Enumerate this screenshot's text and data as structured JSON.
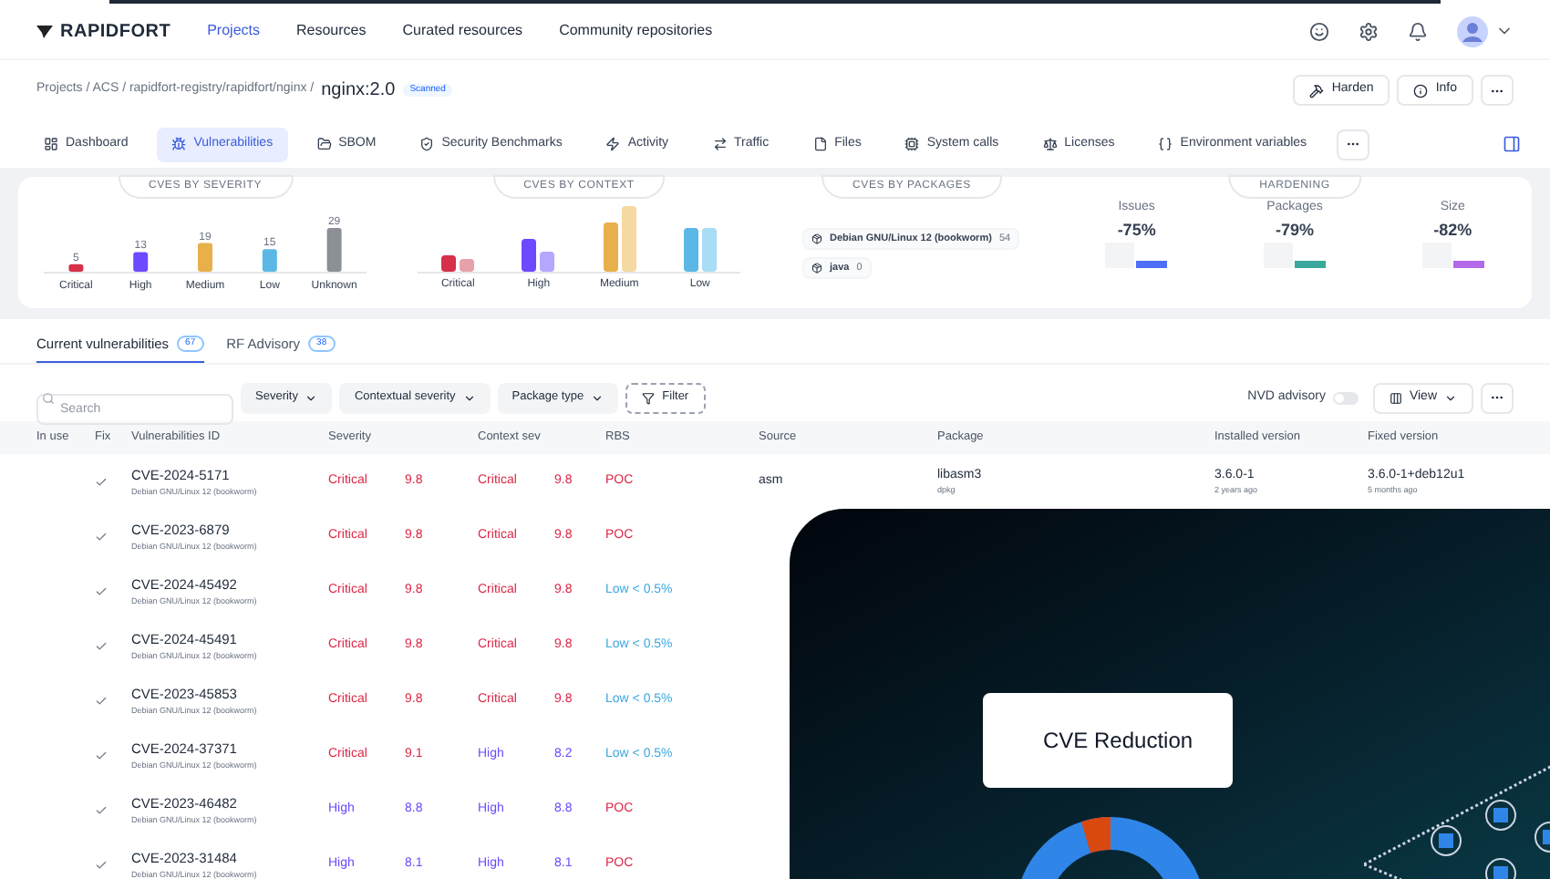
{
  "nav": {
    "brand": "RAPIDFORT",
    "items": [
      {
        "label": "Projects",
        "selected": true
      },
      {
        "label": "Resources",
        "selected": false
      },
      {
        "label": "Curated resources",
        "selected": false
      },
      {
        "label": "Community repositories",
        "selected": false
      }
    ]
  },
  "breadcrumb": {
    "path": "Projects / ACS / rapidfort-registry/rapidfort/nginx /",
    "image": "nginx:2.0",
    "badge": "Scanned",
    "actions": [
      "Harden",
      "Info"
    ]
  },
  "tabs": [
    {
      "label": "Dashboard",
      "selected": false
    },
    {
      "label": "Vulnerabilities",
      "selected": true
    },
    {
      "label": "SBOM",
      "selected": false
    },
    {
      "label": "Security Benchmarks",
      "selected": false
    },
    {
      "label": "Activity",
      "selected": false
    },
    {
      "label": "Traffic",
      "selected": false
    },
    {
      "label": "Files",
      "selected": false
    },
    {
      "label": "System calls",
      "selected": false
    },
    {
      "label": "Licenses",
      "selected": false
    },
    {
      "label": "Environment variables",
      "selected": false
    }
  ],
  "summary": {
    "severity": {
      "heading": "CVES BY SEVERITY",
      "chart_data": {
        "type": "bar",
        "categories": [
          "Critical",
          "High",
          "Medium",
          "Low",
          "Unknown"
        ],
        "values": [
          5,
          13,
          19,
          15,
          29
        ],
        "data_labels": true
      }
    },
    "context": {
      "heading": "CVES BY CONTEXT",
      "categories": [
        "Critical",
        "High",
        "Medium",
        "Low"
      ]
    },
    "packages": {
      "heading": "CVES BY PACKAGES",
      "items": [
        {
          "name": "Debian GNU/Linux 12 (bookworm)",
          "count": "54"
        },
        {
          "name": "java",
          "count": "0"
        }
      ]
    },
    "hardening": {
      "heading": "HARDENING",
      "stats": [
        {
          "label": "Issues",
          "value": "-75%",
          "color": "#4f6ef7"
        },
        {
          "label": "Packages",
          "value": "-79%",
          "color": "#3aa89c"
        },
        {
          "label": "Size",
          "value": "-82%",
          "color": "#b36ae8"
        }
      ]
    }
  },
  "subtabs": [
    {
      "label": "Current vulnerabilities",
      "count": "67",
      "selected": true
    },
    {
      "label": "RF Advisory",
      "count": "38",
      "selected": false
    }
  ],
  "filters": {
    "search_placeholder": "Search",
    "dropdowns": [
      "Severity",
      "Contextual severity",
      "Package type"
    ],
    "filter": "Filter",
    "nvd": {
      "label": "NVD advisory",
      "on": false
    },
    "view": "View"
  },
  "table": {
    "columns": [
      "In use",
      "Fix",
      "Vulnerabilities ID",
      "Severity",
      "Context sev",
      "RBS",
      "Source",
      "Package",
      "Installed version",
      "Fixed version"
    ],
    "rows": [
      {
        "fix": true,
        "id": "CVE-2024-5171",
        "os": "Debian GNU/Linux 12 (bookworm)",
        "severity": {
          "kind": "critical",
          "label": "Critical",
          "score": "9.8"
        },
        "context": {
          "kind": "critical",
          "label": "Critical",
          "score": "9.8"
        },
        "rbs": {
          "kind": "poc",
          "label": "POC"
        },
        "source": "asm",
        "package": "libasm3",
        "package_type": "dpkg",
        "installed": "3.6.0-1",
        "installed_age": "2 years ago",
        "fixed": "3.6.0-1+deb12u1",
        "fixed_age": "5 months ago"
      },
      {
        "fix": true,
        "id": "CVE-2023-6879",
        "os": "Debian GNU/Linux 12 (bookworm)",
        "severity": {
          "kind": "critical",
          "label": "Critical",
          "score": "9.8"
        },
        "context": {
          "kind": "critical",
          "label": "Critical",
          "score": "9.8"
        },
        "rbs": {
          "kind": "poc",
          "label": "POC"
        }
      },
      {
        "fix": true,
        "id": "CVE-2024-45492",
        "os": "Debian GNU/Linux 12 (bookworm)",
        "severity": {
          "kind": "critical",
          "label": "Critical",
          "score": "9.8"
        },
        "context": {
          "kind": "critical",
          "label": "Critical",
          "score": "9.8"
        },
        "rbs": {
          "kind": "low",
          "label": "Low < 0.5%"
        }
      },
      {
        "fix": true,
        "id": "CVE-2024-45491",
        "os": "Debian GNU/Linux 12 (bookworm)",
        "severity": {
          "kind": "critical",
          "label": "Critical",
          "score": "9.8"
        },
        "context": {
          "kind": "critical",
          "label": "Critical",
          "score": "9.8"
        },
        "rbs": {
          "kind": "low",
          "label": "Low < 0.5%"
        }
      },
      {
        "fix": true,
        "id": "CVE-2023-45853",
        "os": "Debian GNU/Linux 12 (bookworm)",
        "severity": {
          "kind": "critical",
          "label": "Critical",
          "score": "9.8"
        },
        "context": {
          "kind": "critical",
          "label": "Critical",
          "score": "9.8"
        },
        "rbs": {
          "kind": "low",
          "label": "Low < 0.5%"
        }
      },
      {
        "fix": true,
        "id": "CVE-2024-37371",
        "os": "Debian GNU/Linux 12 (bookworm)",
        "severity": {
          "kind": "critical",
          "label": "Critical",
          "score": "9.1"
        },
        "context": {
          "kind": "high",
          "label": "High",
          "score": "8.2"
        },
        "rbs": {
          "kind": "low",
          "label": "Low < 0.5%"
        }
      },
      {
        "fix": true,
        "id": "CVE-2023-46482",
        "os": "Debian GNU/Linux 12 (bookworm)",
        "severity": {
          "kind": "high",
          "label": "High",
          "score": "8.8"
        },
        "context": {
          "kind": "high",
          "label": "High",
          "score": "8.8"
        },
        "rbs": {
          "kind": "poc",
          "label": "POC"
        }
      },
      {
        "fix": true,
        "id": "CVE-2023-31484",
        "os": "Debian GNU/Linux 12 (bookworm)",
        "severity": {
          "kind": "high",
          "label": "High",
          "score": "8.1"
        },
        "context": {
          "kind": "high",
          "label": "High",
          "score": "8.1"
        },
        "rbs": {
          "kind": "poc",
          "label": "POC"
        }
      }
    ]
  },
  "promo": {
    "label": "CVE Reduction"
  }
}
